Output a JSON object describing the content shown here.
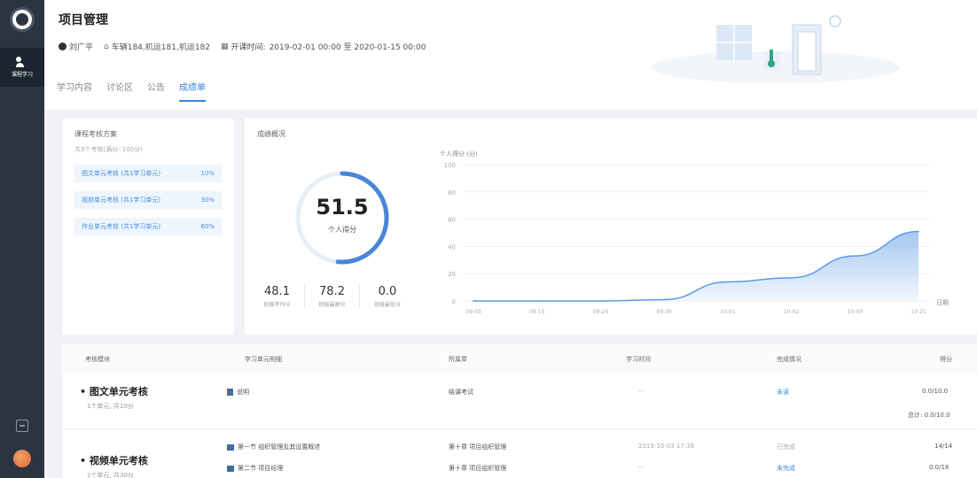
{
  "header": {
    "title": "项目管理",
    "teacher": "刘广平",
    "location": "车辆184,机运181,机运182",
    "time_prefix": "开课时间:",
    "time_range": "2019-02-01 00:00 至 2020-01-15 00:00"
  },
  "tabs": [
    {
      "label": "学习内容",
      "active": false
    },
    {
      "label": "讨论区",
      "active": false
    },
    {
      "label": "公告",
      "active": false
    },
    {
      "label": "成绩单",
      "active": true
    }
  ],
  "sidebar": {
    "active_label": "课程学习"
  },
  "plan": {
    "title": "课程考核方案",
    "subtitle": "共3个考核(满分: 100分)",
    "items": [
      {
        "label": "图文单元考核 (共1学习单元)",
        "weight": "10%"
      },
      {
        "label": "视频单元考核 (共1学习单元)",
        "weight": "30%"
      },
      {
        "label": "作业单元考核 (共1学习单元)",
        "weight": "60%"
      }
    ]
  },
  "overview": {
    "title": "成绩概况",
    "score": "51.5",
    "score_fraction": 0.515,
    "score_label": "个人得分",
    "stats": [
      {
        "value": "48.1",
        "label": "班级平均分"
      },
      {
        "value": "78.2",
        "label": "班级最高分"
      },
      {
        "value": "0.0",
        "label": "班级最低分"
      }
    ]
  },
  "chart_data": {
    "type": "area",
    "ylabel": "个人得分 (分)",
    "xlabel": "日期",
    "ylim": [
      0,
      100
    ],
    "yticks": [
      0,
      20,
      40,
      60,
      80,
      100
    ],
    "categories": [
      "09-03",
      "09-15",
      "09-24",
      "09-30",
      "10-01",
      "10-02",
      "10-03",
      "10-21"
    ],
    "values": [
      0,
      0,
      0,
      1,
      14,
      17,
      33,
      51
    ],
    "color": "#5b9be6"
  },
  "table": {
    "headers": [
      "考核模块",
      "学习单元明细",
      "所属章",
      "学习时间",
      "完成情况",
      "得分"
    ],
    "groups": [
      {
        "title": "图文单元考核",
        "subtitle": "1个单元, 共10分",
        "rows": [
          {
            "unit": "说明",
            "chapter": "结课考试",
            "time": "--",
            "status": "未读",
            "score": "0.0/10.0"
          }
        ],
        "total": "总计: 0.0/10.0"
      },
      {
        "title": "视频单元考核",
        "subtitle": "2个单元, 共30分",
        "rows": [
          {
            "unit": "第一节 组织管理及其设置概述",
            "chapter": "第十章 项目组织管理",
            "time": "2019-10-03 17:38",
            "status": "已完成",
            "score": "14/14"
          },
          {
            "unit": "第二节 项目经理",
            "chapter": "第十章 项目组织管理",
            "time": "--",
            "status": "未完成",
            "score": "0.0/16"
          }
        ]
      }
    ]
  }
}
